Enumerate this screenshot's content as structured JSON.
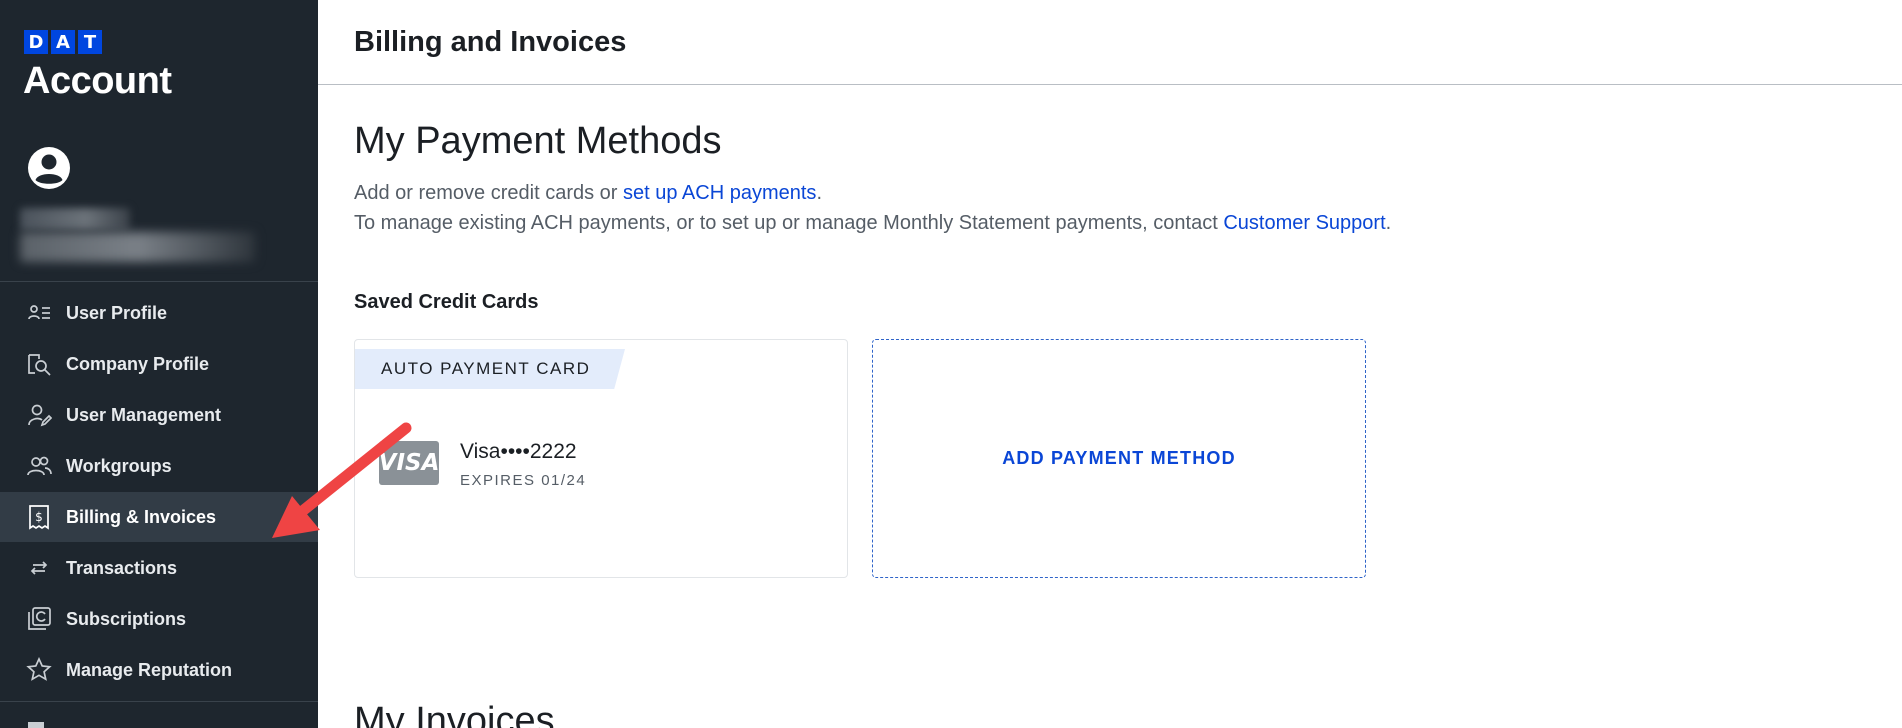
{
  "sidebar": {
    "logo_letters": [
      "D",
      "A",
      "T"
    ],
    "title": "Account",
    "items": [
      {
        "label": "User Profile",
        "icon": "user-list-icon",
        "active": false
      },
      {
        "label": "Company Profile",
        "icon": "company-search-icon",
        "active": false
      },
      {
        "label": "User Management",
        "icon": "user-edit-icon",
        "active": false
      },
      {
        "label": "Workgroups",
        "icon": "group-icon",
        "active": false
      },
      {
        "label": "Billing & Invoices",
        "icon": "receipt-dollar-icon",
        "active": true
      },
      {
        "label": "Transactions",
        "icon": "swap-arrows-icon",
        "active": false
      },
      {
        "label": "Subscriptions",
        "icon": "subscriptions-icon",
        "active": false
      },
      {
        "label": "Manage Reputation",
        "icon": "star-icon",
        "active": false
      }
    ]
  },
  "header": {
    "title": "Billing and Invoices"
  },
  "payment_methods": {
    "heading": "My Payment Methods",
    "line1_text": "Add or remove credit cards or ",
    "line1_link": "set up ACH payments",
    "line1_end": ".",
    "line2_text": "To manage existing ACH payments, or to set up or manage Monthly Statement payments, contact ",
    "line2_link": "Customer Support",
    "line2_end": "."
  },
  "saved_cards": {
    "title": "Saved Credit Cards",
    "card": {
      "tag": "AUTO PAYMENT CARD",
      "brand_logo": "VISA",
      "number": "Visa••••2222",
      "expiry": "EXPIRES 01/24"
    },
    "add_label": "ADD PAYMENT METHOD"
  },
  "invoices": {
    "heading": "My Invoices"
  },
  "colors": {
    "sidebar_bg": "#1e262e",
    "active_bg": "#323c46",
    "link": "#0a46d6",
    "brand_blue": "#0046e0",
    "annotation_arrow": "#ef4444"
  }
}
